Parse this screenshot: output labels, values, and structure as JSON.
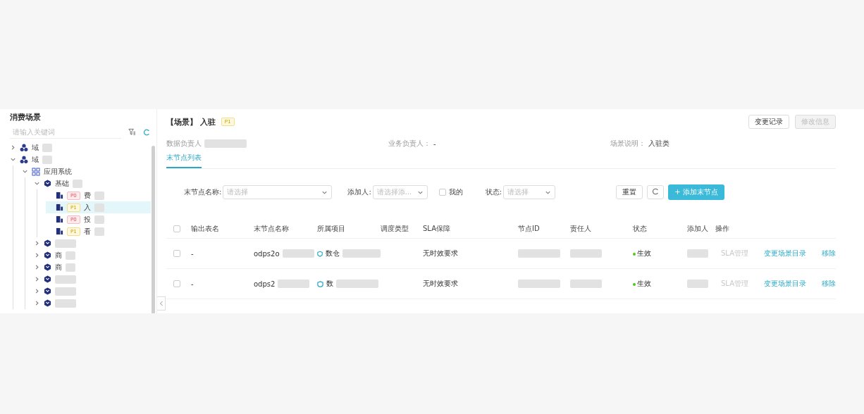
{
  "sidebar": {
    "title": "消费场景",
    "search": {
      "placeholder": "请输入关键词"
    },
    "tree": [
      {
        "kind": "domain",
        "label": "域",
        "redacted": true,
        "expanded": false,
        "selected": false
      },
      {
        "kind": "domain",
        "label": "域",
        "redacted": true,
        "expanded": true,
        "selected": false,
        "children": [
          {
            "kind": "system",
            "label": "应用系统",
            "expanded": true,
            "selected": false,
            "children": [
              {
                "kind": "app",
                "label": "基础",
                "redacted": true,
                "expanded": true,
                "selected": false,
                "children": [
                  {
                    "kind": "table",
                    "badge": "P0",
                    "label": "费",
                    "redacted": true,
                    "selected": false
                  },
                  {
                    "kind": "table",
                    "badge": "P1",
                    "label": "入",
                    "redacted": true,
                    "selected": true
                  },
                  {
                    "kind": "table",
                    "badge": "P0",
                    "label": "投",
                    "redacted": true,
                    "selected": false
                  },
                  {
                    "kind": "table",
                    "badge": "P1",
                    "label": "看",
                    "redacted": true,
                    "selected": false
                  }
                ]
              },
              {
                "kind": "app",
                "redacted": true,
                "expanded": false,
                "selected": false
              },
              {
                "kind": "app",
                "label": "商",
                "redacted": true,
                "expanded": false,
                "selected": false
              },
              {
                "kind": "app",
                "label": "商",
                "redacted": true,
                "expanded": false,
                "selected": false
              },
              {
                "kind": "app",
                "redacted": true,
                "expanded": false,
                "selected": false
              },
              {
                "kind": "app",
                "redacted": true,
                "expanded": false,
                "selected": false
              },
              {
                "kind": "app",
                "redacted": true,
                "expanded": false,
                "selected": false
              }
            ]
          }
        ]
      }
    ]
  },
  "header": {
    "title": "【场景】 入驻",
    "badge": "P1",
    "buttons": [
      {
        "label": "变更记录",
        "disabled": false
      },
      {
        "label": "修改信息",
        "disabled": true
      }
    ]
  },
  "info": [
    {
      "label": "数据负责人",
      "redacted": true
    },
    {
      "label": "业务负责人：",
      "value": "-"
    },
    {
      "label": "场景说明：",
      "value": "入驻类"
    }
  ],
  "tabs": [
    {
      "label": "末节点列表",
      "selected": true
    }
  ],
  "filters": {
    "node_name": {
      "label": "末节点名称:",
      "placeholder": "请选择"
    },
    "adder": {
      "label": "添加人:",
      "placeholder": "请选择添..."
    },
    "mine": {
      "label": "我的",
      "checked": false
    },
    "status": {
      "label": "状态:",
      "placeholder": "请选择"
    },
    "reset": "重置",
    "add": "+ 添加末节点"
  },
  "table": {
    "select_all": {
      "checked": false
    },
    "columns": [
      "输出表名",
      "末节点名称",
      "所属项目",
      "调度类型",
      "SLA保障",
      "节点ID",
      "责任人",
      "状态",
      "添加人",
      "操作"
    ],
    "rows": [
      {
        "checked": false,
        "output_table": "-",
        "node_name": {
          "text": "odps2o",
          "redacted": true
        },
        "project": {
          "text": "数仓",
          "redacted": true
        },
        "sla": "无时效要求",
        "node_id": {
          "redacted": true
        },
        "owner": {
          "redacted": true
        },
        "status": "生效",
        "adder": {
          "redacted": true
        },
        "actions": [
          {
            "label": "SLA管理",
            "disabled": true
          },
          {
            "label": "变更场景目录",
            "disabled": false
          },
          {
            "label": "移除",
            "disabled": false
          }
        ]
      },
      {
        "checked": false,
        "output_table": "-",
        "node_name": {
          "text": "odps2",
          "redacted": true
        },
        "project": {
          "text": "数",
          "redacted": true
        },
        "sla": "无时效要求",
        "node_id": {
          "redacted": true
        },
        "owner": {
          "redacted": true
        },
        "status": "生效",
        "adder": {
          "redacted": true
        },
        "actions": [
          {
            "label": "SLA管理",
            "disabled": true
          },
          {
            "label": "变更场景目录",
            "disabled": false
          },
          {
            "label": "移除",
            "disabled": false
          }
        ]
      }
    ]
  }
}
